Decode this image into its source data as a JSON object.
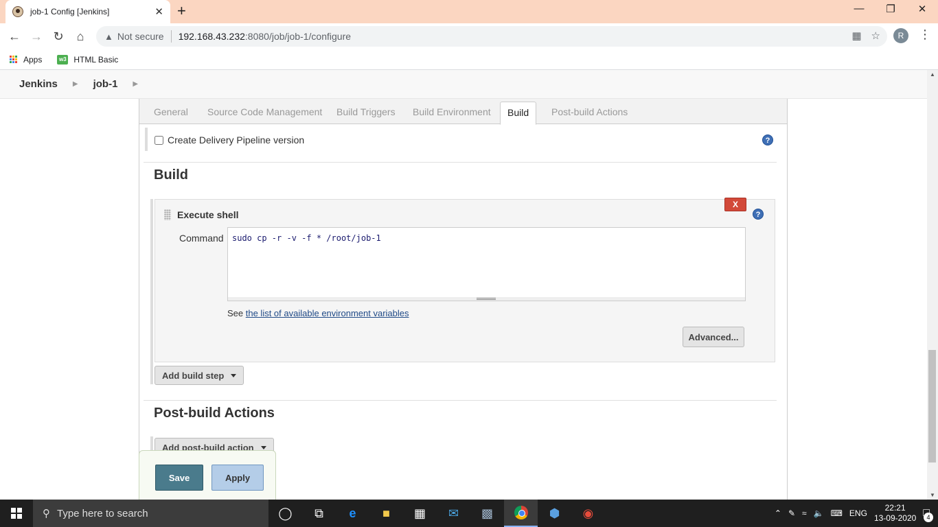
{
  "browser": {
    "tab_title": "job-1 Config [Jenkins]",
    "tab_close": "✕",
    "new_tab": "+",
    "not_secure": "Not secure",
    "url_host": "192.168.43.232",
    "url_rest": ":8080/job/job-1/configure",
    "profile_initial": "R",
    "bookmarks": [
      {
        "label": "Apps",
        "icon": "apps-grid-icon"
      },
      {
        "label": "HTML Basic",
        "icon": "w3schools-icon"
      }
    ]
  },
  "breadcrumb": {
    "root": "Jenkins",
    "job": "job-1"
  },
  "tabs": [
    {
      "label": "General",
      "active": false
    },
    {
      "label": "Source Code Management",
      "active": false
    },
    {
      "label": "Build Triggers",
      "active": false
    },
    {
      "label": "Build Environment",
      "active": false
    },
    {
      "label": "Build",
      "active": true
    },
    {
      "label": "Post-build Actions",
      "active": false
    }
  ],
  "pipeline_option": {
    "label": "Create Delivery Pipeline version",
    "checked": false
  },
  "build": {
    "heading": "Build",
    "step": {
      "title": "Execute shell",
      "delete_label": "X",
      "command_label": "Command",
      "command_value": "sudo cp -r -v -f * /root/job-1",
      "env_prefix": "See ",
      "env_link": "the list of available environment variables",
      "advanced_label": "Advanced..."
    },
    "add_step_label": "Add build step"
  },
  "post_build": {
    "heading": "Post-build Actions",
    "add_action_label": "Add post-build action"
  },
  "actions": {
    "save_label": "Save",
    "apply_label": "Apply"
  },
  "help_glyph": "?",
  "taskbar": {
    "search_placeholder": "Type here to search",
    "language": "ENG",
    "time": "22:21",
    "date": "13-09-2020",
    "notification_count": "4"
  },
  "colors": {
    "tabstrip": "#fbd6c1",
    "save_button": "#4a7b8c",
    "apply_button": "#b4cde8",
    "delete_button": "#d24939",
    "help_icon": "#3f6fb5",
    "taskbar": "#1f1f1f"
  }
}
